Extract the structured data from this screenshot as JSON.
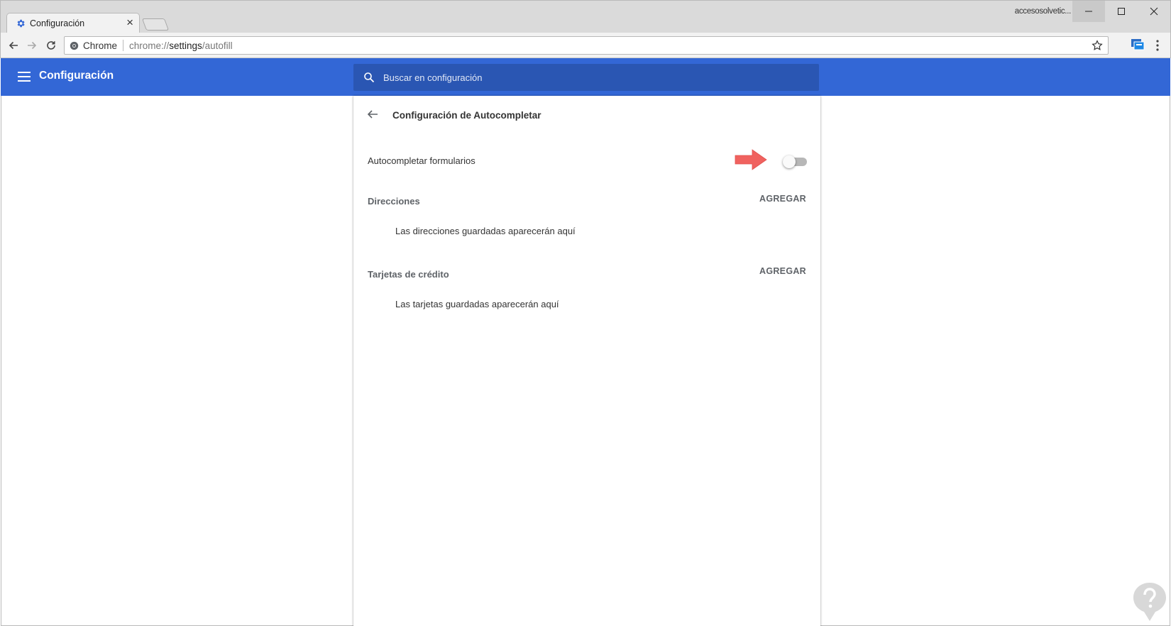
{
  "browser": {
    "tab": {
      "title": "Configuración",
      "favicon": "gear-icon",
      "close": "×"
    },
    "profile_name": "accesosolvetic...",
    "window_controls": {
      "minimize": "minimize-icon",
      "maximize": "maximize-icon",
      "close": "close-icon"
    },
    "omnibox": {
      "site_label": "Chrome",
      "url_prefix": "chrome://",
      "url_host": "settings",
      "url_path": "/autofill"
    }
  },
  "settings": {
    "header_title": "Configuración",
    "search": {
      "placeholder": "Buscar en configuración",
      "value": ""
    },
    "subpage_title": "Configuración de Autocompletar",
    "autofill_forms": {
      "label": "Autocompletar formularios",
      "enabled": false
    },
    "addresses": {
      "title": "Direcciones",
      "add_label": "AGREGAR",
      "empty_text": "Las direcciones guardadas aparecerán aquí"
    },
    "credit_cards": {
      "title": "Tarjetas de crédito",
      "add_label": "AGREGAR",
      "empty_text": "Las tarjetas guardadas aparecerán aquí"
    }
  },
  "colors": {
    "header_blue": "#3367d6",
    "search_blue": "#2a56b3",
    "pointer_red": "#f0625f"
  }
}
